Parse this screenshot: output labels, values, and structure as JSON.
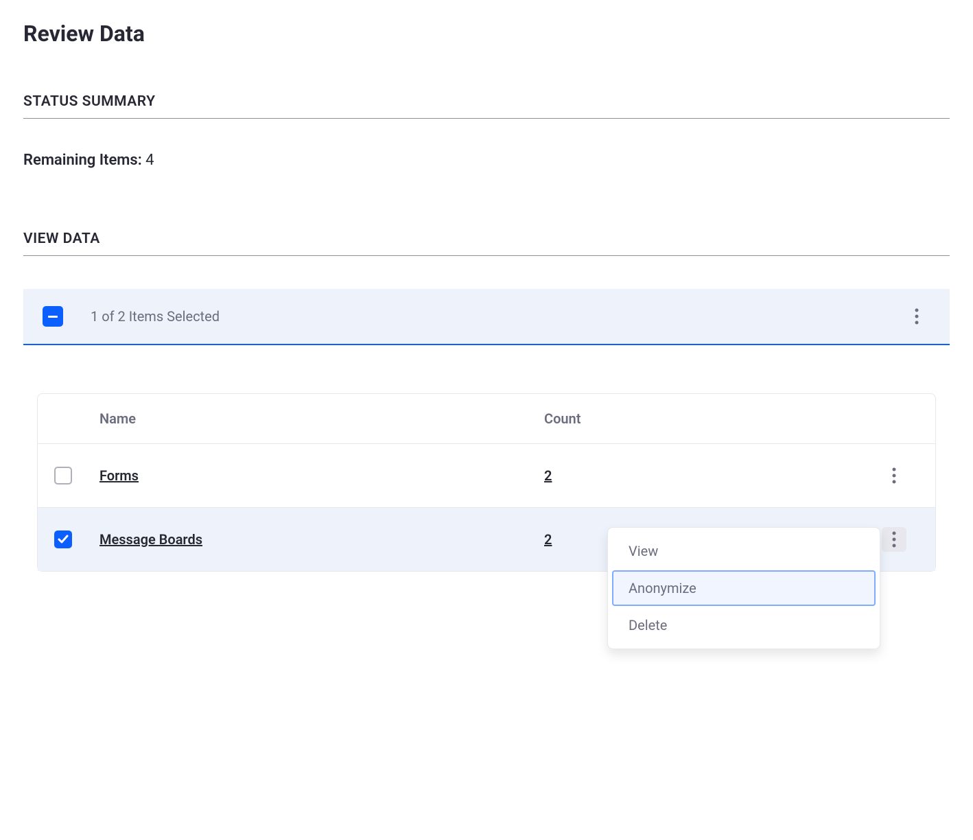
{
  "page": {
    "title": "Review Data"
  },
  "status": {
    "section_header": "STATUS SUMMARY",
    "remaining_label": "Remaining Items:",
    "remaining_value": "4"
  },
  "view_data": {
    "section_header": "VIEW DATA",
    "selection_text": "1 of 2 Items Selected",
    "columns": {
      "name": "Name",
      "count": "Count"
    },
    "rows": [
      {
        "name": "Forms",
        "count": "2",
        "checked": false
      },
      {
        "name": "Message Boards",
        "count": "2",
        "checked": true
      }
    ],
    "dropdown": {
      "view": "View",
      "anonymize": "Anonymize",
      "delete": "Delete"
    }
  }
}
